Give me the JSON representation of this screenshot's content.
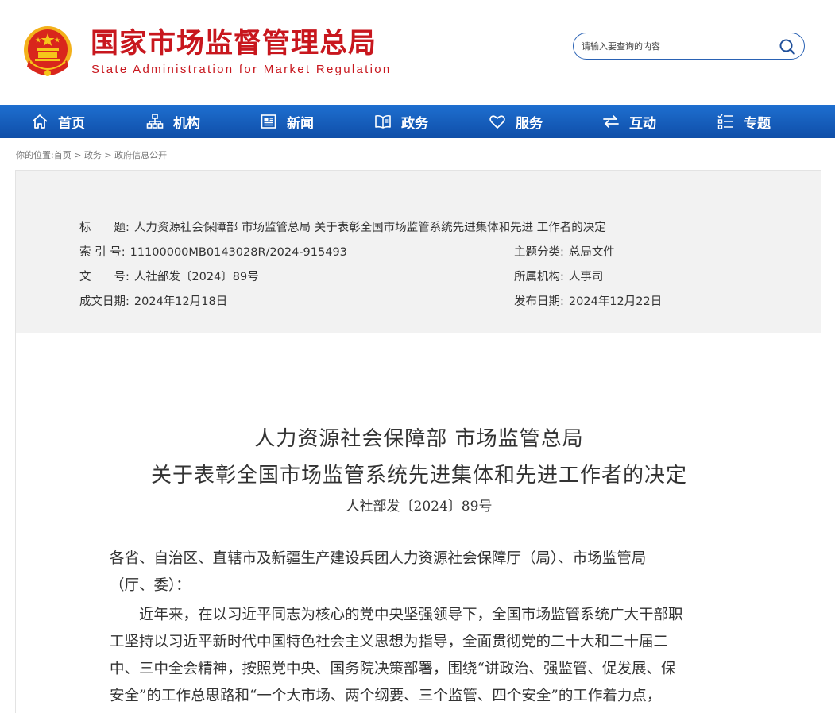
{
  "header": {
    "site_title": "国家市场监督管理总局",
    "site_subtitle": "State Administration for Market Regulation",
    "search_placeholder": "请输入要查询的内容"
  },
  "nav": {
    "items": [
      {
        "label": "首页",
        "icon": "home-icon"
      },
      {
        "label": "机构",
        "icon": "org-chart-icon"
      },
      {
        "label": "新闻",
        "icon": "news-icon"
      },
      {
        "label": "政务",
        "icon": "book-icon"
      },
      {
        "label": "服务",
        "icon": "heart-icon"
      },
      {
        "label": "互动",
        "icon": "exchange-arrows-icon"
      },
      {
        "label": "专题",
        "icon": "topics-list-icon"
      }
    ]
  },
  "breadcrumb": {
    "prefix": "你的位置:",
    "home": "首页",
    "sep1": " > ",
    "level1": "政务",
    "sep2": " > ",
    "level2": "政府信息公开"
  },
  "meta": {
    "title_label": "标　　题:",
    "title_value": "人力资源社会保障部 市场监管总局 关于表彰全国市场监管系统先进集体和先进 工作者的决定",
    "index_label": "索 引 号:",
    "index_value": "11100000MB0143028R/2024-915493",
    "topic_label": "主题分类:",
    "topic_value": "总局文件",
    "docno_label": "文　　号:",
    "docno_value": "人社部发〔2024〕89号",
    "org_label": "所属机构:",
    "org_value": "人事司",
    "created_label": "成文日期:",
    "created_value": "2024年12月18日",
    "published_label": "发布日期:",
    "published_value": "2024年12月22日"
  },
  "article": {
    "title_line1": "人力资源社会保障部  市场监管总局",
    "title_line2": "关于表彰全国市场监管系统先进集体和先进工作者的决定",
    "doc_number": "人社部发〔2024〕89号",
    "lines": [
      "各省、自治区、直辖市及新疆生产建设兵团人力资源社会保障厅（局）、市场监管局",
      "（厅、委）：",
      "　　近年来，在以习近平同志为核心的党中央坚强领导下，全国市场监管系统广大干部职",
      "工坚持以习近平新时代中国特色社会主义思想为指导，全面贯彻党的二十大和二十届二",
      "中、三中全会精神，按照党中央、国务院决策部署，围绕“讲政治、强监管、促发展、保",
      "安全”的工作总思路和“一个大市场、两个纲要、三个监管、四个安全”的工作着力点，"
    ]
  },
  "colors": {
    "brand_red": "#c8171e",
    "nav_blue": "#1565c0",
    "search_border": "#2a62b4"
  }
}
